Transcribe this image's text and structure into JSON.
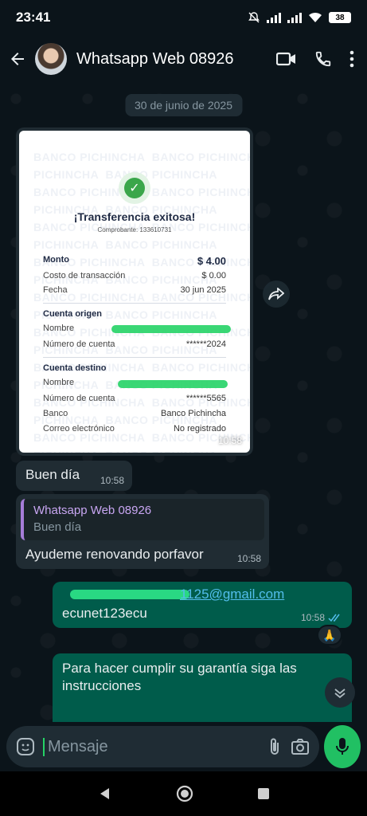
{
  "status": {
    "time": "23:41",
    "battery": "38"
  },
  "header": {
    "contact_name": "Whatsapp Web 08926"
  },
  "chat": {
    "date_chip": "30 de junio de 2025",
    "receipt": {
      "watermark": "BANCO PICHINCHA",
      "title": "¡Transferencia exitosa!",
      "comprobante": "Comprobante: 133610731",
      "monto_label": "Monto",
      "monto_value": "$ 4.00",
      "costo_label": "Costo de transacción",
      "costo_value": "$ 0.00",
      "fecha_label": "Fecha",
      "fecha_value": "30 jun 2025",
      "origen_head": "Cuenta origen",
      "origen_nombre_label": "Nombre",
      "origen_numero_label": "Número de cuenta",
      "origen_numero_value": "******2024",
      "destino_head": "Cuenta destino",
      "destino_nombre_label": "Nombre",
      "destino_numero_label": "Número de cuenta",
      "destino_numero_value": "******5565",
      "banco_label": "Banco",
      "banco_value": "Banco Pichincha",
      "correo_label": "Correo electrónico",
      "correo_value": "No registrado",
      "time": "10:58"
    },
    "msg1": {
      "text": "Buen día",
      "time": "10:58"
    },
    "msg2": {
      "quote_name": "Whatsapp Web 08926",
      "quote_text": "Buen día",
      "text": "Ayudeme renovando porfavor",
      "time": "10:58"
    },
    "msg3": {
      "link": "1125@gmail.com",
      "text": "ecunet123ecu",
      "time": "10:58",
      "reaction": "🙏"
    },
    "msg4": {
      "text": "Para hacer cumplir su garantía siga las instrucciones"
    }
  },
  "input": {
    "placeholder": "Mensaje"
  },
  "colors": {
    "accent": "#25d366",
    "outgoing": "#005c4b",
    "incoming": "#202c33",
    "quote_bar": "#a67dd8",
    "link": "#53bdeb"
  }
}
